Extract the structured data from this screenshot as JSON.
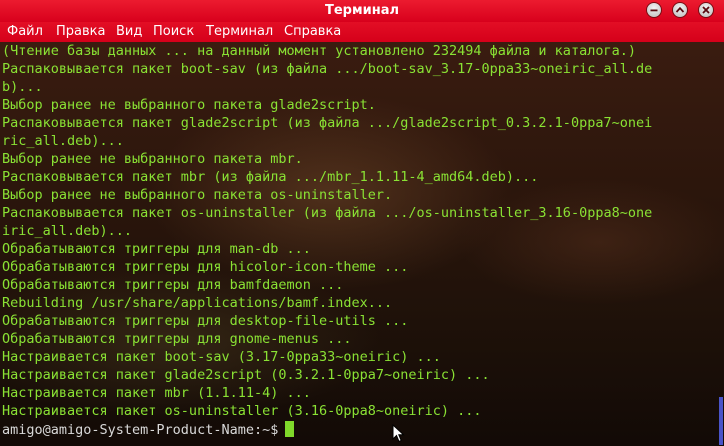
{
  "window": {
    "title": "Терминал"
  },
  "menu": [
    "Файл",
    "Правка",
    "Вид",
    "Поиск",
    "Терминал",
    "Справка"
  ],
  "terminal": {
    "lines": [
      "(Чтение базы данных ... на данный момент установлено 232494 файла и каталога.)",
      "Распаковывается пакет boot-sav (из файла .../boot-sav_3.17-0ppa33~oneiric_all.de",
      "b)...",
      "Выбор ранее не выбранного пакета glade2script.",
      "Распаковывается пакет glade2script (из файла .../glade2script_0.3.2.1-0ppa7~onei",
      "ric_all.deb)...",
      "Выбор ранее не выбранного пакета mbr.",
      "Распаковывается пакет mbr (из файла .../mbr_1.1.11-4_amd64.deb)...",
      "Выбор ранее не выбранного пакета os-uninstaller.",
      "Распаковывается пакет os-uninstaller (из файла .../os-uninstaller_3.16-0ppa8~one",
      "iric_all.deb)...",
      "Обрабатываются триггеры для man-db ...",
      "Обрабатываются триггеры для hicolor-icon-theme ...",
      "Обрабатываются триггеры для bamfdaemon ...",
      "Rebuilding /usr/share/applications/bamf.index...",
      "Обрабатываются триггеры для desktop-file-utils ...",
      "Обрабатываются триггеры для gnome-menus ...",
      "Настраивается пакет boot-sav (3.17-0ppa33~oneiric) ...",
      "Настраивается пакет glade2script (0.3.2.1-0ppa7~oneiric) ...",
      "Настраивается пакет mbr (1.1.11-4) ...",
      "Настраивается пакет os-uninstaller (3.16-0ppa8~oneiric) ..."
    ],
    "prompt": "amigo@amigo-System-Product-Name:~$"
  },
  "icons": {
    "minimize": "minimize-icon",
    "maximize": "maximize-icon",
    "close": "close-icon",
    "pointer": "mouse-pointer-icon"
  },
  "colors": {
    "titlebar": "#e0061f",
    "menubar": "#d9001b",
    "output_text": "#8ae234",
    "prompt_text": "#d9d9d9",
    "cursor": "#7fd82a",
    "scrollbar": "#4a54c8"
  }
}
